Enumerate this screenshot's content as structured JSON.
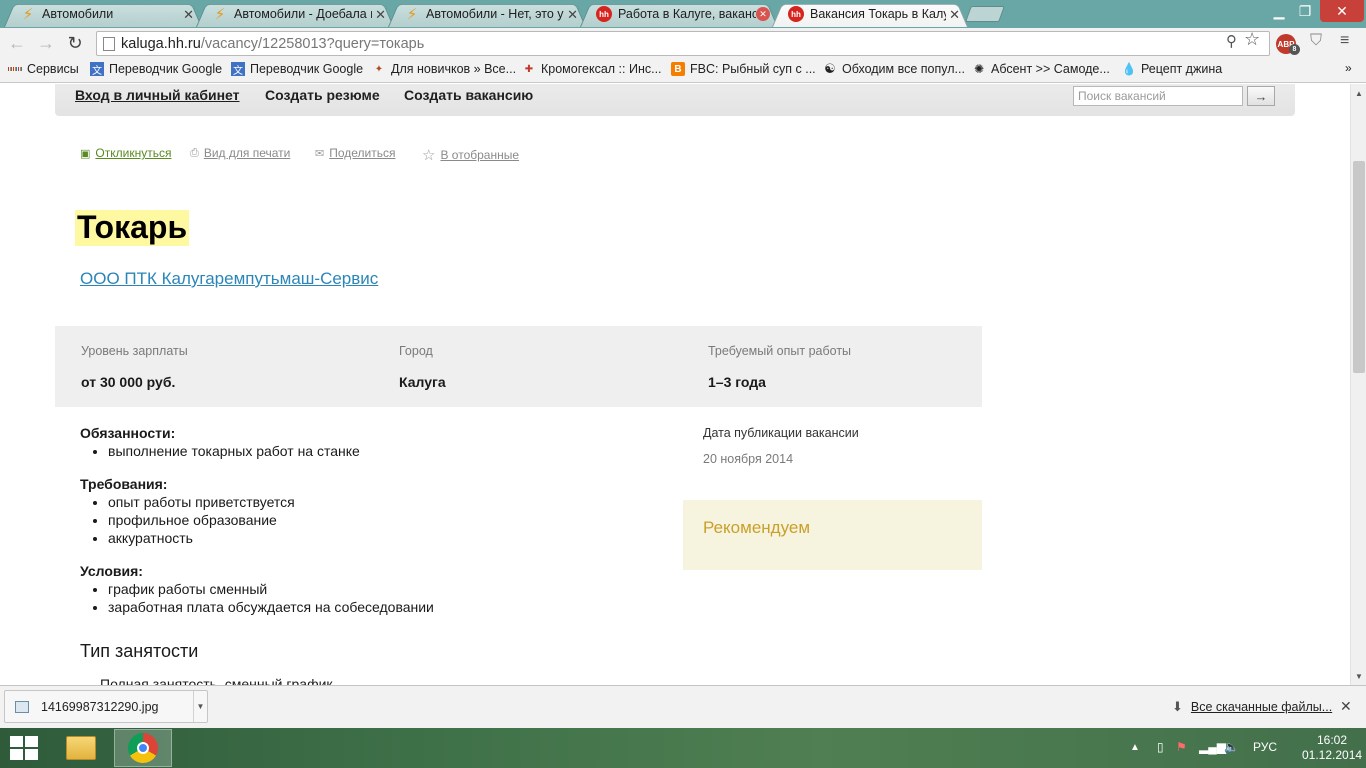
{
  "browser": {
    "tabs": [
      {
        "title": "Автомобили",
        "icon": "bolt-icon",
        "active": false
      },
      {
        "title": "Автомобили - Доебала в",
        "icon": "bolt-icon",
        "active": false
      },
      {
        "title": "Автомобили - Нет, это у",
        "icon": "bolt-icon",
        "active": false
      },
      {
        "title": "Работа в Калуге, ваканси",
        "icon": "hh-icon",
        "active": false
      },
      {
        "title": "Вакансия Токарь в Калуге",
        "icon": "hh-icon",
        "active": true
      }
    ],
    "hh_icon_text": "hh",
    "url_host": "kaluga.hh.ru",
    "url_path": "/vacancy/12258013?query=токарь",
    "ext_abp": "ABP",
    "ext_abp_badge": "8",
    "bookmarks": [
      {
        "label": "Сервисы",
        "icon": "apps-icon"
      },
      {
        "label": "Переводчик Google",
        "icon": "translate-icon"
      },
      {
        "label": "Переводчик Google",
        "icon": "translate-icon"
      },
      {
        "label": "Для новичков » Все...",
        "icon": "game-icon"
      },
      {
        "label": "Кромогексал :: Инс...",
        "icon": "pharma-icon"
      },
      {
        "label": "FBC: Рыбный суп с ...",
        "icon": "blogger-icon"
      },
      {
        "label": "Обходим все попул...",
        "icon": "yin-yang-icon"
      },
      {
        "label": "Абсент >> Самоде...",
        "icon": "star-icon"
      },
      {
        "label": "Рецепт джина",
        "icon": "drop-icon"
      }
    ]
  },
  "site_nav": {
    "login": "Вход в личный кабинет",
    "create_resume": "Создать резюме",
    "create_vacancy": "Создать вакансию",
    "search_placeholder": "Поиск вакансий",
    "search_button": "→"
  },
  "actions": {
    "respond": "Откликнуться",
    "print": "Вид для печати",
    "share": "Поделиться",
    "favorite": "В отобранные"
  },
  "vacancy": {
    "title": "Токарь",
    "company": "ООО ПТК Калугаремпутьмаш-Сервис",
    "salary_label": "Уровень зарплаты",
    "salary_value": "от 30 000 руб.",
    "city_label": "Город",
    "city_value": "Калуга",
    "experience_label": "Требуемый опыт работы",
    "experience_value": "1–3 года",
    "sections": [
      {
        "heading": "Обязанности:",
        "items": [
          "выполнение токарных работ на станке"
        ]
      },
      {
        "heading": "Требования:",
        "items": [
          "опыт работы приветствуется",
          "профильное образование",
          "аккуратность"
        ]
      },
      {
        "heading": "Условия:",
        "items": [
          "график работы сменный",
          "заработная плата обсуждается на собеседовании"
        ]
      }
    ],
    "employment_title": "Тип занятости",
    "employment_value": "Полная занятость, сменный график",
    "pubdate_label": "Дата публикации вакансии",
    "pubdate": "20 ноября 2014",
    "recommend": "Рекомендуем"
  },
  "downloads": {
    "file_name": "14169987312290.jpg",
    "all_downloads": "Все скачанные файлы..."
  },
  "taskbar": {
    "language": "РУС",
    "time": "16:02",
    "date": "01.12.2014"
  }
}
